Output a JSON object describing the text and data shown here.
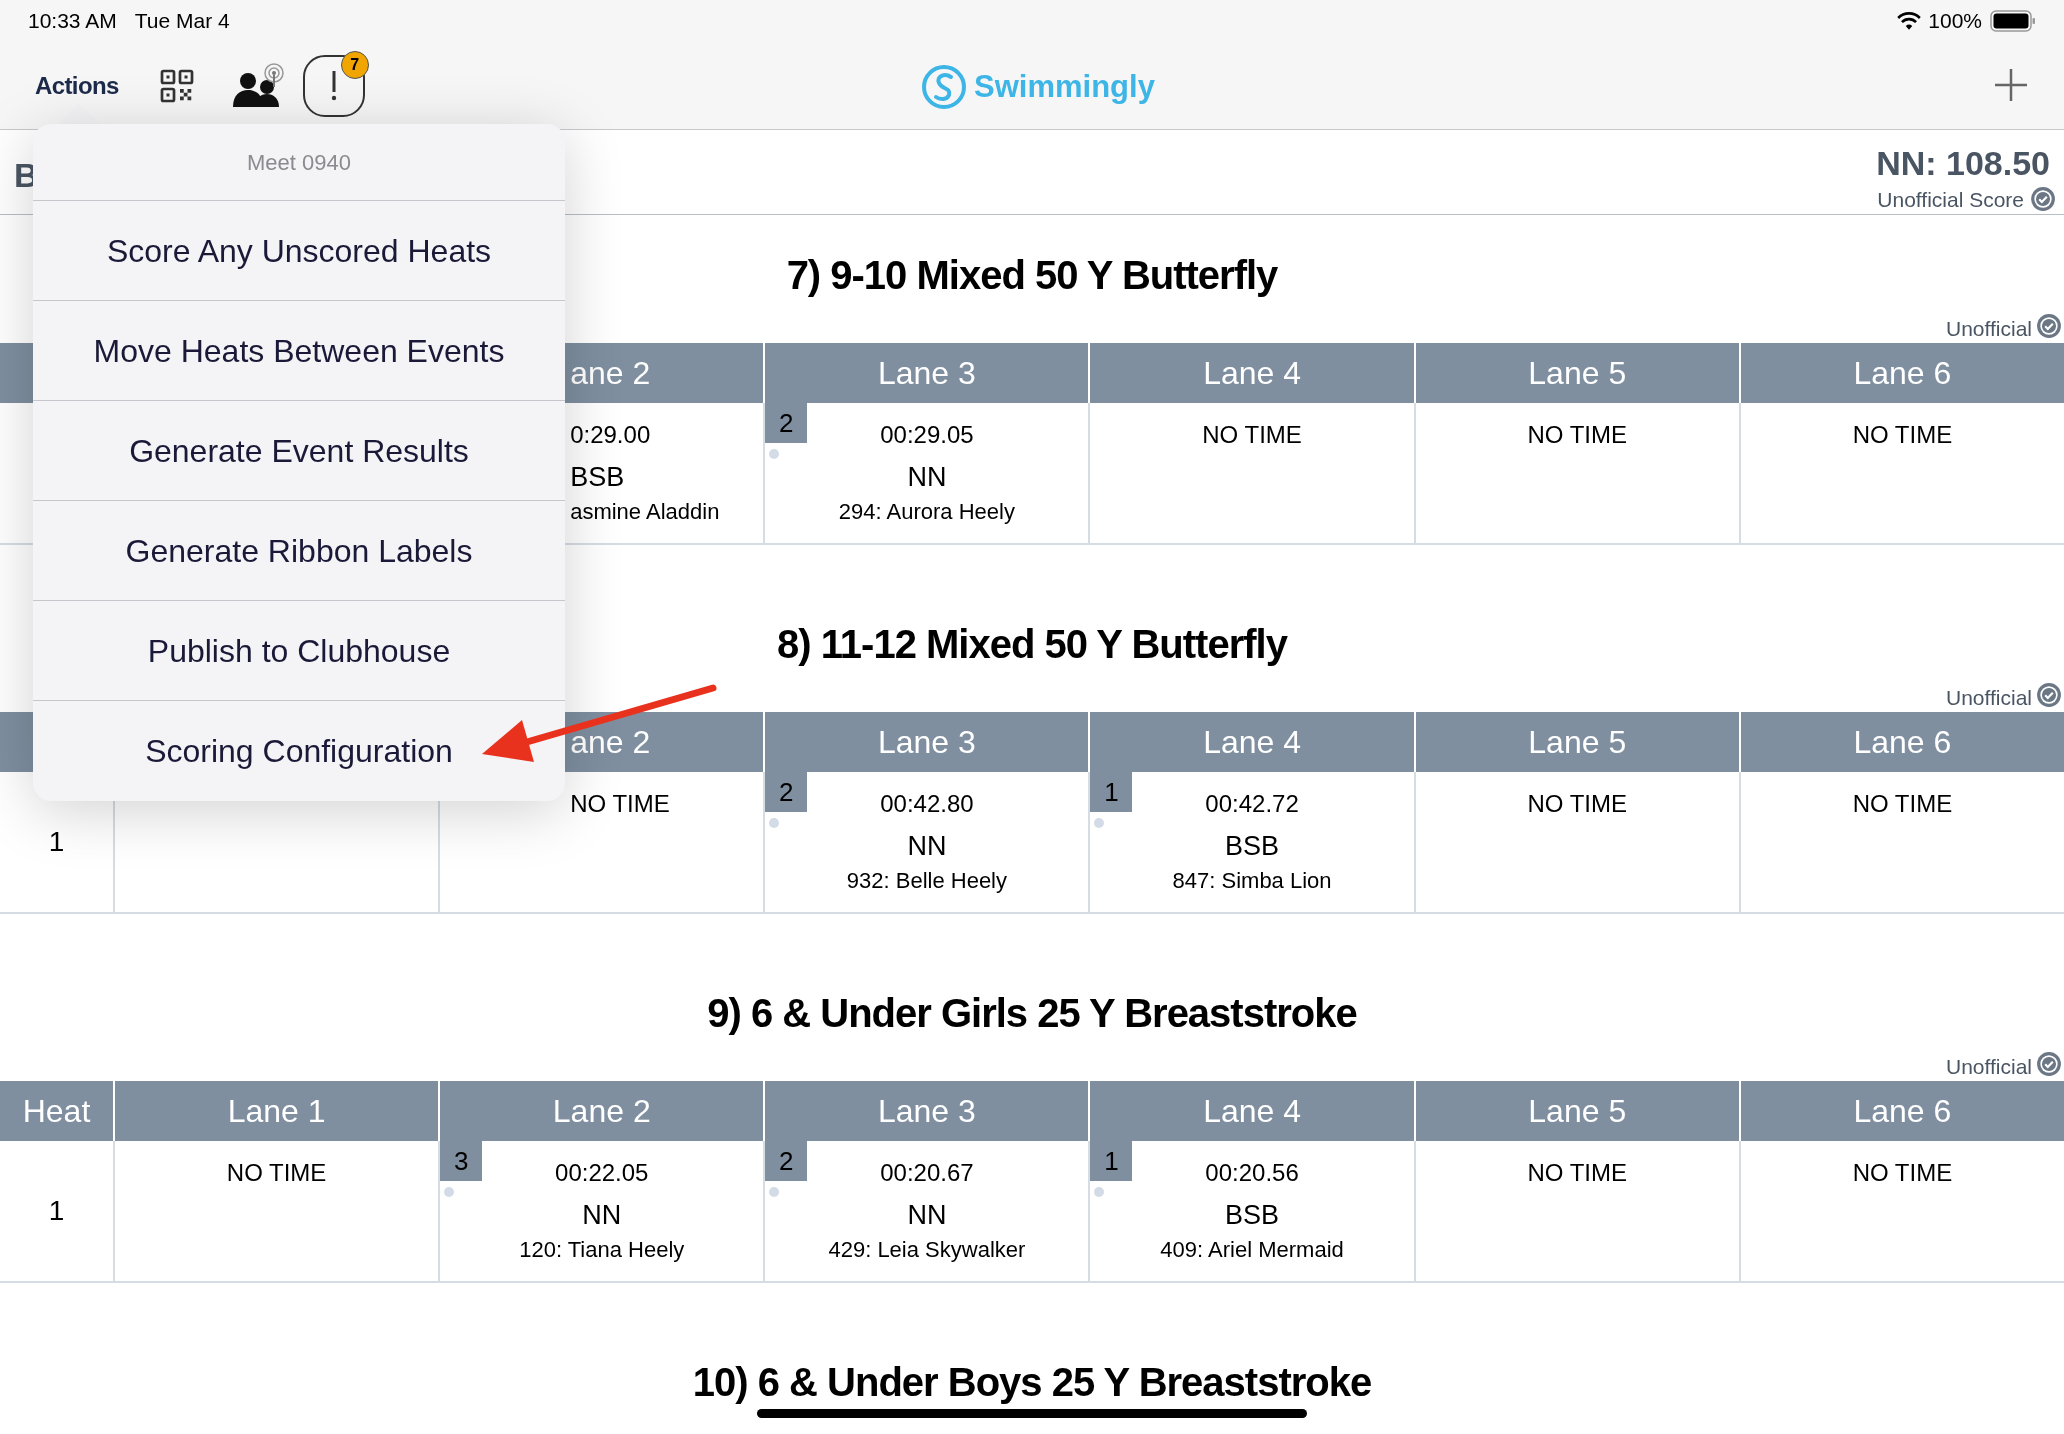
{
  "status_bar": {
    "time": "10:33 AM",
    "date": "Tue Mar 4",
    "battery": "100%"
  },
  "nav_bar": {
    "actions": "Actions",
    "alert_count": "7",
    "logo": "Swimmingly"
  },
  "score_header": {
    "team_partial": "B",
    "score": "NN: 108.50",
    "status": "Unofficial Score"
  },
  "events": [
    {
      "title": "7) 9-10 Mixed 50 Y Butterfly",
      "status": "Unofficial",
      "columns": [
        {},
        {},
        {
          "label": "ane 2",
          "kind": "cut"
        },
        {
          "label": "Lane 3"
        },
        {
          "label": "Lane 4"
        },
        {
          "label": "Lane 5"
        },
        {
          "label": "Lane 6"
        }
      ],
      "rows": [
        {
          "cells": [
            "",
            "",
            {
              "kind": "cut",
              "time": "0:29.00",
              "team": "BSB",
              "swimmer": "asmine Aladdin"
            },
            {
              "kind": "result",
              "place": "2",
              "time": "00:29.05",
              "team": "NN",
              "swimmer": "294: Aurora Heely"
            },
            {
              "kind": "result",
              "time": "NO TIME"
            },
            {
              "kind": "result",
              "time": "NO TIME"
            },
            {
              "kind": "result",
              "time": "NO TIME"
            }
          ]
        }
      ]
    },
    {
      "title": "8) 11-12 Mixed 50 Y Butterfly",
      "status": "Unofficial",
      "columns": [
        {},
        {},
        {
          "label": "ane 2",
          "kind": "cut"
        },
        {
          "label": "Lane 3"
        },
        {
          "label": "Lane 4"
        },
        {
          "label": "Lane 5"
        },
        {
          "label": "Lane 6"
        }
      ],
      "rows": [
        {
          "cells": [
            "1",
            "",
            {
              "kind": "cut",
              "time": "NO TIME"
            },
            {
              "kind": "result",
              "place": "2",
              "time": "00:42.80",
              "team": "NN",
              "swimmer": "932: Belle Heely"
            },
            {
              "kind": "result",
              "place": "1",
              "time": "00:42.72",
              "team": "BSB",
              "swimmer": "847: Simba Lion"
            },
            {
              "kind": "result",
              "time": "NO TIME"
            },
            {
              "kind": "result",
              "time": "NO TIME"
            }
          ]
        }
      ]
    },
    {
      "title": "9) 6 & Under Girls 25 Y Breaststroke",
      "status": "Unofficial",
      "columns": [
        {
          "label": "Heat"
        },
        {
          "label": "Lane 1"
        },
        {
          "label": "Lane 2"
        },
        {
          "label": "Lane 3"
        },
        {
          "label": "Lane 4"
        },
        {
          "label": "Lane 5"
        },
        {
          "label": "Lane 6"
        }
      ],
      "rows": [
        {
          "cells": [
            "1",
            {
              "kind": "result",
              "time": "NO TIME"
            },
            {
              "kind": "result",
              "place": "3",
              "time": "00:22.05",
              "team": "NN",
              "swimmer": "120: Tiana Heely"
            },
            {
              "kind": "result",
              "place": "2",
              "time": "00:20.67",
              "team": "NN",
              "swimmer": "429: Leia Skywalker"
            },
            {
              "kind": "result",
              "place": "1",
              "time": "00:20.56",
              "team": "BSB",
              "swimmer": "409: Ariel Mermaid"
            },
            {
              "kind": "result",
              "time": "NO TIME"
            },
            {
              "kind": "result",
              "time": "NO TIME"
            }
          ]
        }
      ]
    },
    {
      "title": "10) 6 & Under Boys 25 Y Breaststroke"
    }
  ],
  "popover": {
    "header": "Meet 0940",
    "items": [
      "Score Any Unscored Heats",
      "Move Heats Between Events",
      "Generate Event Results",
      "Generate Ribbon Labels",
      "Publish to Clubhouse",
      "Scoring Configuration"
    ]
  }
}
